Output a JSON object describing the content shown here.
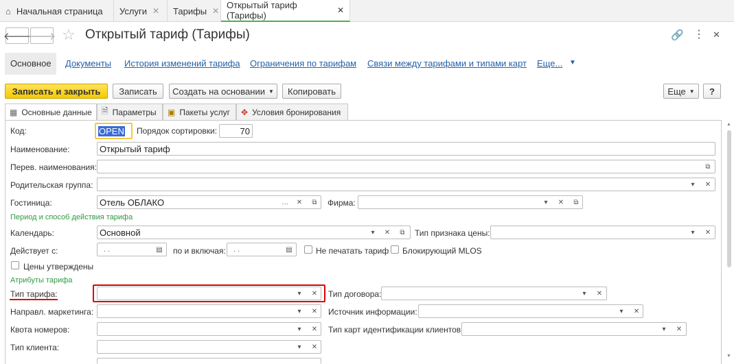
{
  "tabs": {
    "home": "Начальная страница",
    "services": "Услуги",
    "tariffs": "Тарифы",
    "current": "Открытый тариф (Тарифы)"
  },
  "window": {
    "title": "Открытый тариф (Тарифы)"
  },
  "links": {
    "main": "Основное",
    "docs": "Документы",
    "history": "История изменений тарифа",
    "limits": "Ограничения по тарифам",
    "relations": "Связи между тарифами и типами карт",
    "more": "Еще..."
  },
  "toolbar": {
    "save_close": "Записать и закрыть",
    "save": "Записать",
    "create_based": "Создать на основании",
    "copy": "Копировать",
    "more": "Еще",
    "help": "?"
  },
  "form_tabs": {
    "main": "Основные данные",
    "params": "Параметры",
    "packages": "Пакеты услуг",
    "booking": "Условия бронирования"
  },
  "fields": {
    "code_label": "Код:",
    "code_value": "OPEN",
    "sort_label": "Порядок сортировки:",
    "sort_value": "70",
    "name_label": "Наименование:",
    "name_value": "Открытый тариф",
    "trans_label": "Перев. наименования:",
    "parent_label": "Родительская группа:",
    "hotel_label": "Гостиница:",
    "hotel_value": "Отель ОБЛАКО",
    "firm_label": "Фирма:",
    "period_section": "Период и способ действия тарифа",
    "calendar_label": "Календарь:",
    "calendar_value": "Основной",
    "price_type_label": "Тип признака цены:",
    "valid_from_label": "Действует с:",
    "valid_from_value": ". .",
    "to_label": "по и включая:",
    "to_value": ". .",
    "no_print_label": "Не печатать тариф",
    "block_mlos_label": "Блокирующий MLOS",
    "prices_approved_label": "Цены утверждены",
    "attrs_section": "Атрибуты тарифа",
    "tariff_type_label": "Тип тарифа:",
    "contract_type_label": "Тип договора:",
    "marketing_label": "Направл. маркетинга:",
    "info_source_label": "Источник информации:",
    "room_quota_label": "Квота номеров:",
    "card_type_label": "Тип карт идентификации клиентов:",
    "client_type_label": "Тип клиента:"
  }
}
